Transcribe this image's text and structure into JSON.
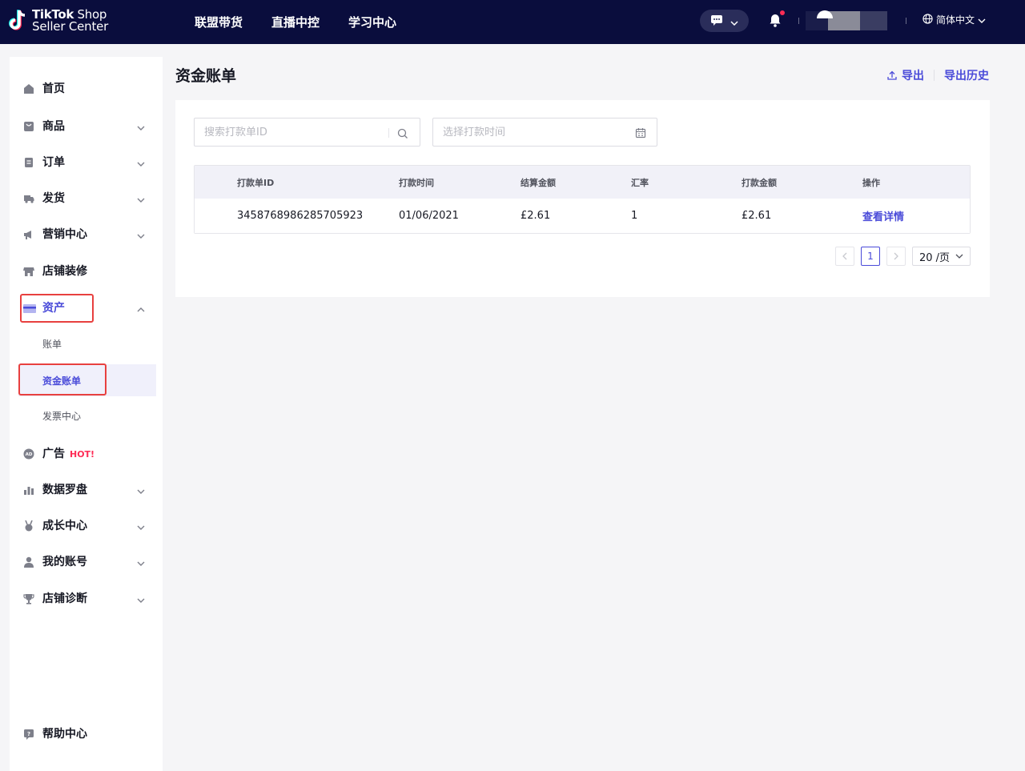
{
  "logo": {
    "line1_bold": "TikTok",
    "line1_light": " Shop",
    "line2": "Seller Center"
  },
  "topnav": [
    {
      "label": "联盟带货"
    },
    {
      "label": "直播中控"
    },
    {
      "label": "学习中心"
    }
  ],
  "header": {
    "language": "简体中文"
  },
  "sidebar": {
    "items": [
      {
        "label": "首页",
        "icon": "home-icon"
      },
      {
        "label": "商品",
        "icon": "product-icon"
      },
      {
        "label": "订单",
        "icon": "order-icon"
      },
      {
        "label": "发货",
        "icon": "truck-icon"
      },
      {
        "label": "营销中心",
        "icon": "megaphone-icon"
      },
      {
        "label": "店铺装修",
        "icon": "store-icon"
      },
      {
        "label": "资产",
        "icon": "card-icon"
      },
      {
        "label": "广告",
        "icon": "ad-icon",
        "badge": "HOT!"
      },
      {
        "label": "数据罗盘",
        "icon": "chart-icon"
      },
      {
        "label": "成长中心",
        "icon": "medal-icon"
      },
      {
        "label": "我的账号",
        "icon": "user-icon"
      },
      {
        "label": "店铺诊断",
        "icon": "trophy-icon"
      },
      {
        "label": "帮助中心",
        "icon": "help-icon"
      }
    ],
    "asset_sub": [
      {
        "label": "账单"
      },
      {
        "label": "资金账单"
      },
      {
        "label": "发票中心"
      }
    ]
  },
  "page": {
    "title": "资金账单",
    "export_label": "导出",
    "export_history_label": "导出历史"
  },
  "filters": {
    "search_placeholder": "搜索打款单ID",
    "date_placeholder": "选择打款时间"
  },
  "table": {
    "headers": [
      "打款单ID",
      "打款时间",
      "结算金额",
      "汇率",
      "打款金额",
      "操作"
    ],
    "rows": [
      {
        "id": "3458768986285705923",
        "time": "01/06/2021",
        "settle": "£2.61",
        "rate": "1",
        "amount": "£2.61",
        "action": "查看详情"
      }
    ]
  },
  "pagination": {
    "current": "1",
    "page_size": "20 /页"
  },
  "colors": {
    "nav_bg": "#0a0d3d",
    "accent": "#4a4bd9",
    "hot": "#fe2c55",
    "highlight_box": "#e8403f"
  }
}
